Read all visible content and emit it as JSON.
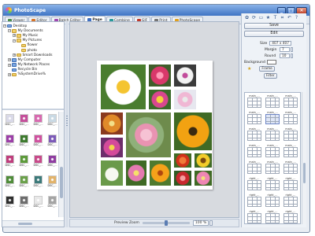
{
  "window": {
    "title": "PhotoScape"
  },
  "window_buttons": [
    "_",
    "□",
    "✕"
  ],
  "tabs": [
    {
      "label": "Viewer",
      "color": "#4c8f4c"
    },
    {
      "label": "Editor",
      "color": "#d8762a"
    },
    {
      "label": "Batch Editor",
      "color": "#a04ab0"
    },
    {
      "label": "Page",
      "color": "#3f6fc0",
      "active": true
    },
    {
      "label": "Combine",
      "color": "#2a9a9a"
    },
    {
      "label": "GIF",
      "color": "#c0392b"
    },
    {
      "label": "Print",
      "color": "#777777"
    },
    {
      "label": "PhotoScape",
      "color": "#e0a020"
    }
  ],
  "tree": [
    {
      "label": "Desktop",
      "expander": "−",
      "folder": "blue"
    },
    {
      "label": "My Documents",
      "expander": "−",
      "folder": "yellow"
    },
    {
      "label": "My Music",
      "expander": "+",
      "folder": "yellow"
    },
    {
      "label": "My Pictures",
      "expander": "−",
      "folder": "yellow"
    },
    {
      "label": "flower",
      "expander": "",
      "folder": "yellow"
    },
    {
      "label": "photo",
      "expander": "",
      "folder": "yellow"
    },
    {
      "label": "Smart Downloads",
      "expander": "+",
      "folder": "yellow"
    },
    {
      "label": "My Computer",
      "expander": "+",
      "folder": "blue"
    },
    {
      "label": "My Network Places",
      "expander": "+",
      "folder": "blue"
    },
    {
      "label": "Recycle Bin",
      "expander": "",
      "folder": "blue"
    },
    {
      "label": "%SystemDrive%",
      "expander": "+",
      "folder": "yellow"
    }
  ],
  "thumbnails": [
    {
      "caption": "DSC_...",
      "color": "#d9d9e8"
    },
    {
      "caption": "DSC_...",
      "color": "#c44f9a"
    },
    {
      "caption": "DSC_...",
      "color": "#d86ab0"
    },
    {
      "caption": "DSC_...",
      "color": "#c9d9e4"
    },
    {
      "caption": "DSC_...",
      "color": "#9c3ea8"
    },
    {
      "caption": "DSC_...",
      "color": "#3d7a2e"
    },
    {
      "caption": "DSC_...",
      "color": "#d052a0"
    },
    {
      "caption": "DSC_...",
      "color": "#7c5ab8"
    },
    {
      "caption": "DSC_...",
      "color": "#bf3d7d"
    },
    {
      "caption": "DSC_...",
      "color": "#5c9a3a"
    },
    {
      "caption": "DSC_...",
      "color": "#c84a8a"
    },
    {
      "caption": "DSC_...",
      "color": "#8e3ca0"
    },
    {
      "caption": "DSC_...",
      "color": "#4f8c39"
    },
    {
      "caption": "DSC_...",
      "color": "#6aa04a"
    },
    {
      "caption": "DSC_...",
      "color": "#3c7a7a"
    },
    {
      "caption": "DSC_...",
      "color": "#e2b36a"
    },
    {
      "caption": "DSC_...",
      "color": "#2f2f2f"
    },
    {
      "caption": "DSC_...",
      "color": "#6d6d6d"
    },
    {
      "caption": "DSC_...",
      "color": "#e8e8e8"
    },
    {
      "caption": "DSC_...",
      "color": "#a4a4a4"
    }
  ],
  "right_panel": {
    "toolbar_icons": [
      {
        "name": "stamp-icon",
        "glyph": "✿"
      },
      {
        "name": "rotate-icon",
        "glyph": "⟳"
      },
      {
        "name": "frame-icon",
        "glyph": "▭"
      },
      {
        "name": "star-icon",
        "glyph": "★"
      },
      {
        "name": "text-icon",
        "glyph": "T"
      },
      {
        "name": "crop-icon",
        "glyph": "⌗"
      },
      {
        "name": "undo-icon",
        "glyph": "↶"
      },
      {
        "name": "help-icon",
        "glyph": "?"
      }
    ],
    "save_label": "Save",
    "edit_label": "Edit",
    "size_label": "Size",
    "size_value": "407 x 407",
    "margin_label": "Margin",
    "margin_value": "7",
    "round_label": "Round",
    "round_value": "10",
    "background_label": "Background",
    "frame_label": "Frame",
    "filter_label": "Filter",
    "templates": [
      "main_...",
      "main_...",
      "main_...",
      "main_...",
      "main_...",
      "main_...",
      "main_...",
      "main_...",
      "main_...",
      "main_...",
      "main_...",
      "main_...",
      "main_...",
      "main_...",
      "main_...",
      "right_...",
      "right_...",
      "right_...",
      "right_...",
      "right_...",
      "right_...",
      "right_...",
      "right_...",
      "right_..."
    ]
  },
  "status": {
    "zoom_label": "Preview Zoom",
    "zoom_value": "100 %",
    "zoom_fraction": 0.5
  },
  "collage_colors": {
    "daisy": "#4a7d2e",
    "pink_rose": "#c4365f",
    "white_flower": "#3b3b3b",
    "orange_gerbera": "#3f6a25",
    "pink_mix": "#6d2d6b",
    "blossom": "#6e8b4c"
  }
}
